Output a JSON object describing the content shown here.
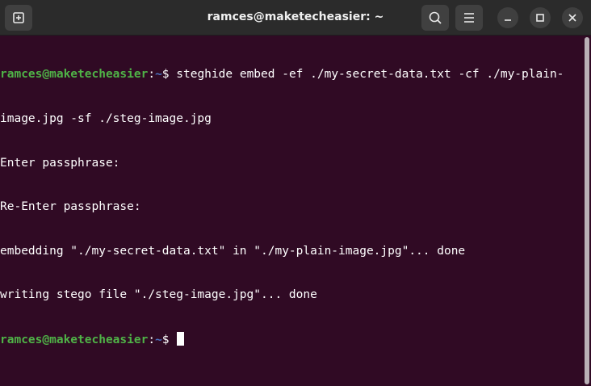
{
  "window": {
    "title": "ramces@maketecheasier: ~"
  },
  "icons": {
    "new_tab": "new-tab-icon",
    "search": "search-icon",
    "menu": "hamburger-menu-icon",
    "minimize": "minimize-icon",
    "maximize": "maximize-icon",
    "close": "close-icon"
  },
  "terminal": {
    "prompt_user": "ramces@maketecheasier",
    "prompt_sep": ":",
    "prompt_path": "~",
    "prompt_symbol": "$ ",
    "command_line1": "steghide embed -ef ./my-secret-data.txt -cf ./my-plain-",
    "command_line2": "image.jpg -sf ./steg-image.jpg",
    "output": [
      "Enter passphrase:",
      "Re-Enter passphrase:",
      "embedding \"./my-secret-data.txt\" in \"./my-plain-image.jpg\"... done",
      "writing stego file \"./steg-image.jpg\"... done"
    ]
  },
  "colors": {
    "background": "#300a24",
    "titlebar": "#2b2b2b",
    "prompt_user": "#4fb347",
    "prompt_path": "#4a72c0",
    "text": "#ffffff"
  }
}
